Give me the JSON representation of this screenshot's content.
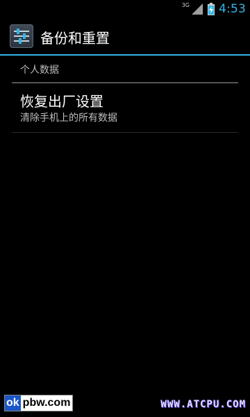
{
  "status_bar": {
    "network_type": "3G",
    "time": "4:53",
    "signal_icon": "signal-icon",
    "battery_icon": "battery-charging-icon"
  },
  "action_bar": {
    "title": "备份和重置",
    "app_icon": "settings-sliders-icon",
    "accent_color": "#33b5e5"
  },
  "section": {
    "header": "个人数据"
  },
  "list": {
    "items": [
      {
        "title": "恢复出厂设置",
        "summary": "清除手机上的所有数据"
      }
    ]
  },
  "watermark": {
    "left_part1": "ok",
    "left_part2": "pbw.com",
    "right": "WWW.ATCPU.COM"
  }
}
